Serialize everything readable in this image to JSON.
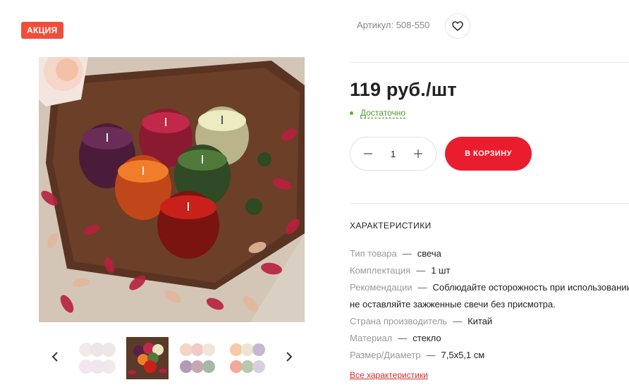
{
  "badge": "АКЦИЯ",
  "sku": "Артикул: 508-550",
  "favorite_icon": "heart-icon",
  "price": "119 руб./шт",
  "stock": "Достаточно",
  "quantity": {
    "value": "1",
    "minus_icon": "minus-icon",
    "plus_icon": "plus-icon"
  },
  "cart_button": "В КОРЗИНУ",
  "specs": {
    "title": "ХАРАКТЕРИСТИКИ",
    "separator": "—",
    "rows": [
      {
        "key": "Тип товара",
        "value": "свеча"
      },
      {
        "key": "Комплектация",
        "value": "1 шт"
      },
      {
        "key": "Рекомендации",
        "value": "Соблюдайте осторожность при использовании,",
        "value_cont": "не оставляйте зажженные свечи без присмотра."
      },
      {
        "key": "Страна производитель",
        "value": "Китай"
      },
      {
        "key": "Материал",
        "value": "стекло"
      },
      {
        "key": "Размер/Диаметр",
        "value": "7,5х5,1 см"
      }
    ],
    "all_link": "Все характеристики"
  },
  "gallery": {
    "prev_icon": "chevron-left-icon",
    "next_icon": "chevron-right-icon",
    "active_index": 1
  },
  "colors": {
    "accent": "#ea1d2e",
    "badge": "#f04e3a",
    "stock": "#4a9a2a"
  }
}
